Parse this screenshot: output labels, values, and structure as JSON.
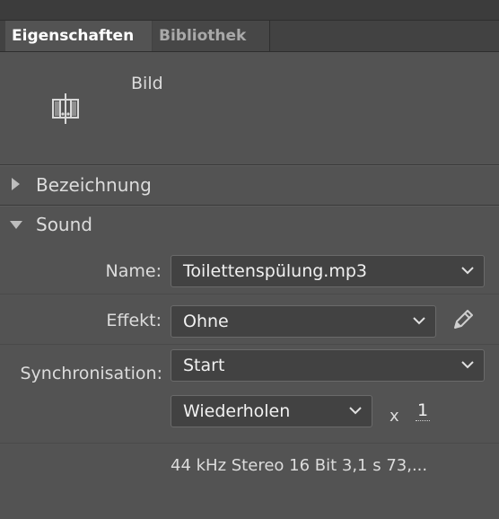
{
  "tabs": [
    {
      "label": "Eigenschaften",
      "active": true
    },
    {
      "label": "Bibliothek",
      "active": false
    }
  ],
  "object_type": "Bild",
  "sections": {
    "bezeichnung": {
      "label": "Bezeichnung",
      "expanded": false
    },
    "sound": {
      "label": "Sound",
      "expanded": true
    }
  },
  "sound": {
    "name_label": "Name:",
    "name_value": "Toilettenspülung.mp3",
    "effekt_label": "Effekt:",
    "effekt_value": "Ohne",
    "sync_label": "Synchronisation:",
    "sync_value": "Start",
    "repeat_mode": "Wiederholen",
    "times_label": "x",
    "repeat_count": "1",
    "info": "44 kHz Stereo 16 Bit 3,1 s 73,..."
  },
  "icons": {
    "symbol": "frame-symbol-icon",
    "edit": "pencil-icon",
    "dropdown": "chevron-down-icon"
  }
}
